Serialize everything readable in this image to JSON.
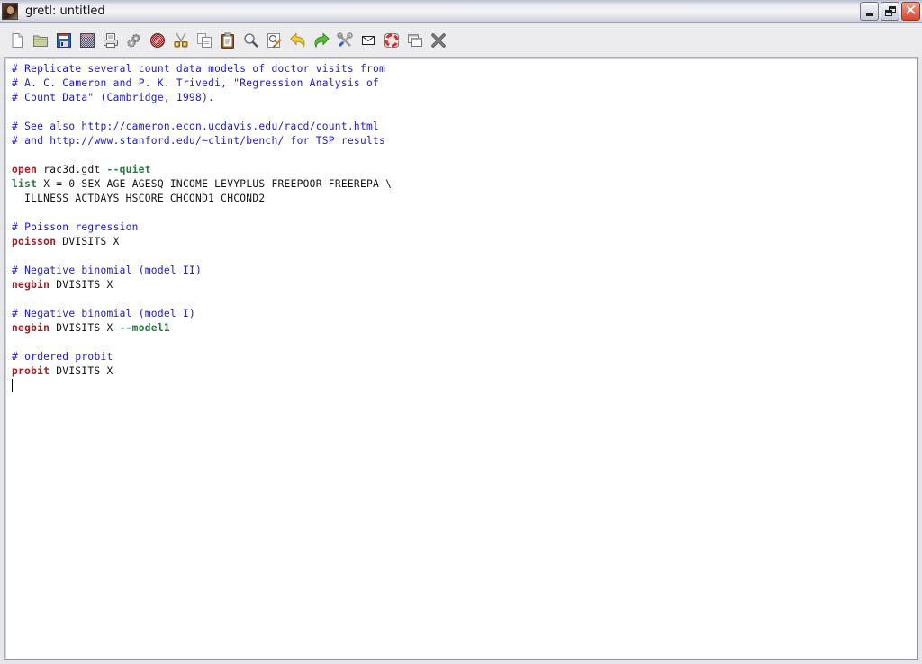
{
  "window": {
    "title": "gretl: untitled",
    "controls": [
      "minimize",
      "maximize",
      "close"
    ]
  },
  "toolbar": {
    "items": [
      {
        "name": "new-file",
        "icon": "new-file-icon"
      },
      {
        "name": "open-file",
        "icon": "folder-icon"
      },
      {
        "name": "save",
        "icon": "save-icon"
      },
      {
        "name": "save-as",
        "icon": "save-as-icon"
      },
      {
        "name": "print",
        "icon": "printer-icon"
      },
      {
        "name": "execute",
        "icon": "gears-icon"
      },
      {
        "name": "stop",
        "icon": "stop-icon"
      },
      {
        "name": "cut",
        "icon": "scissors-icon"
      },
      {
        "name": "copy",
        "icon": "copy-icon"
      },
      {
        "name": "paste",
        "icon": "clipboard-icon"
      },
      {
        "name": "find",
        "icon": "magnifier-icon"
      },
      {
        "name": "replace",
        "icon": "find-replace-icon"
      },
      {
        "name": "undo",
        "icon": "undo-icon"
      },
      {
        "name": "redo",
        "icon": "redo-icon"
      },
      {
        "name": "preferences",
        "icon": "tools-icon"
      },
      {
        "name": "send-email",
        "icon": "envelope-icon"
      },
      {
        "name": "help",
        "icon": "lifebuoy-icon"
      },
      {
        "name": "new-window",
        "icon": "windows-icon"
      },
      {
        "name": "close",
        "icon": "x-icon"
      }
    ]
  },
  "editor": {
    "lines": [
      [
        {
          "t": "# Replicate several count data models of doctor visits from",
          "c": "comment"
        }
      ],
      [
        {
          "t": "# A. C. Cameron and P. K. Trivedi, \"Regression Analysis of",
          "c": "comment"
        }
      ],
      [
        {
          "t": "# Count Data\" (Cambridge, 1998).",
          "c": "comment"
        }
      ],
      [],
      [
        {
          "t": "# See also http://cameron.econ.ucdavis.edu/racd/count.html",
          "c": "comment"
        }
      ],
      [
        {
          "t": "# and http://www.stanford.edu/~clint/bench/ for TSP results",
          "c": "comment"
        }
      ],
      [],
      [
        {
          "t": "open",
          "c": "kw"
        },
        {
          "t": " rac3d.gdt ",
          "c": "plain"
        },
        {
          "t": "--quiet",
          "c": "opt"
        }
      ],
      [
        {
          "t": "list",
          "c": "kw2"
        },
        {
          "t": " X = 0 SEX AGE AGESQ INCOME LEVYPLUS FREEPOOR FREEREPA \\",
          "c": "plain"
        }
      ],
      [
        {
          "t": "  ILLNESS ACTDAYS HSCORE CHCOND1 CHCOND2",
          "c": "plain"
        }
      ],
      [],
      [
        {
          "t": "# Poisson regression",
          "c": "comment"
        }
      ],
      [
        {
          "t": "poisson",
          "c": "kw"
        },
        {
          "t": " DVISITS X",
          "c": "plain"
        }
      ],
      [],
      [
        {
          "t": "# Negative binomial (model II)",
          "c": "comment"
        }
      ],
      [
        {
          "t": "negbin",
          "c": "kw"
        },
        {
          "t": " DVISITS X",
          "c": "plain"
        }
      ],
      [],
      [
        {
          "t": "# Negative binomial (model I)",
          "c": "comment"
        }
      ],
      [
        {
          "t": "negbin",
          "c": "kw"
        },
        {
          "t": " DVISITS X ",
          "c": "plain"
        },
        {
          "t": "--model1",
          "c": "opt"
        }
      ],
      [],
      [
        {
          "t": "# ordered probit",
          "c": "comment"
        }
      ],
      [
        {
          "t": "probit",
          "c": "kw"
        },
        {
          "t": " DVISITS X",
          "c": "plain"
        }
      ]
    ]
  },
  "colors": {
    "comment": "#1a1ad0",
    "command": "#9e2020",
    "option": "#247a3d"
  }
}
